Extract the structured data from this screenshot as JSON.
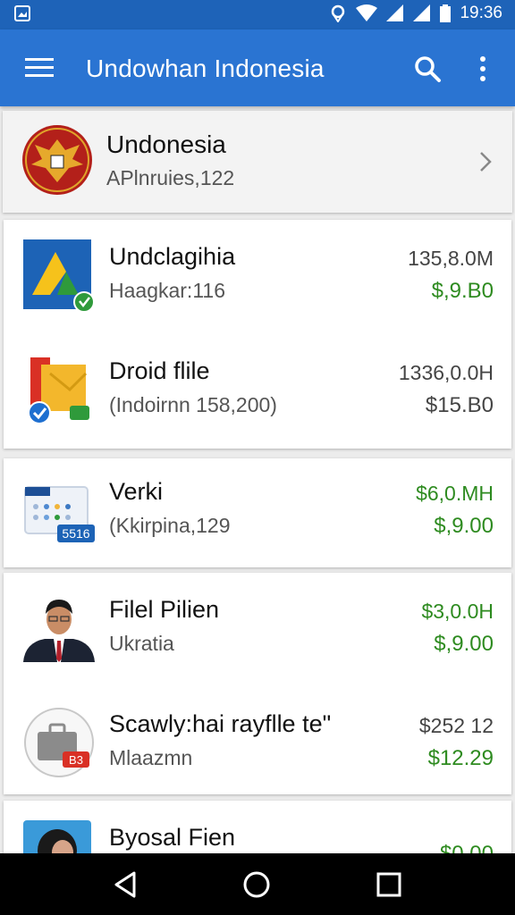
{
  "status_bar": {
    "time": "19:36"
  },
  "app_bar": {
    "title": "Undowhan Indonesia"
  },
  "header": {
    "name": "Undonesia",
    "subtitle": "APlnruies,122"
  },
  "rows": [
    {
      "name": "Undclagihia",
      "sub": "Haagkar:116",
      "v1": "135,8.0M",
      "v2": "$,9.B0",
      "icon": "triangle-app-icon"
    },
    {
      "name": "Droid flile",
      "sub": "(Indoirnn 158,200)",
      "v1": "1336,0.0H",
      "v2": "$15.B0",
      "icon": "folder-app-icon"
    },
    {
      "name": "Verki",
      "sub": "(Kkirpina,129",
      "v1": "$6,0.MH",
      "v2": "$,9.00",
      "icon": "calendar-app-icon",
      "badge": "5516"
    },
    {
      "name": "Filel Pilien",
      "sub": "Ukratia",
      "v1": "$3,0.0H",
      "v2": "$,9.00",
      "icon": "person-avatar"
    },
    {
      "name": "Scawly:hai rayflle te\"",
      "sub": "Mlaazmn",
      "v1": "$252 12",
      "v2": "$12.29",
      "icon": "briefcase-app-icon",
      "badge": "B3"
    },
    {
      "name": "Byosal Fien",
      "sub": "",
      "v1": "",
      "v2": "$0.00",
      "icon": "person-avatar"
    }
  ],
  "colors": {
    "primary": "#2a74d2",
    "status": "#1e63b8",
    "money": "#2e8b20"
  }
}
